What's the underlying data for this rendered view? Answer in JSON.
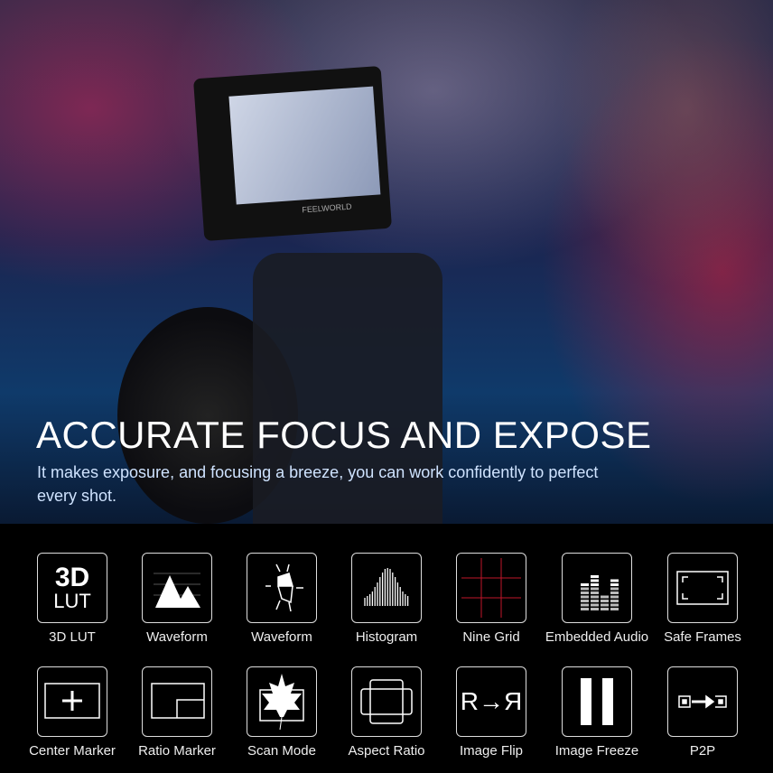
{
  "hero": {
    "headline": "ACCURATE FOCUS AND EXPOSE",
    "subtext": "It makes exposure, and focusing a breeze, you can work confidently to perfect every shot.",
    "monitor_brand": "FEELWORLD"
  },
  "features": [
    {
      "label": "3D LUT",
      "icon": "3d-lut-icon",
      "icon_text_top": "3D",
      "icon_text_bottom": "LUT"
    },
    {
      "label": "Waveform",
      "icon": "waveform-mountain-icon"
    },
    {
      "label": "Waveform",
      "icon": "waveform-vectorscope-icon"
    },
    {
      "label": "Histogram",
      "icon": "histogram-icon"
    },
    {
      "label": "Nine Grid",
      "icon": "nine-grid-icon"
    },
    {
      "label": "Embedded Audio",
      "icon": "audio-meter-icon"
    },
    {
      "label": "Safe Frames",
      "icon": "safe-frames-icon"
    },
    {
      "label": "Center Marker",
      "icon": "center-marker-icon"
    },
    {
      "label": "Ratio Marker",
      "icon": "ratio-marker-icon"
    },
    {
      "label": "Scan Mode",
      "icon": "scan-mode-leaf-icon"
    },
    {
      "label": "Aspect Ratio",
      "icon": "aspect-ratio-icon"
    },
    {
      "label": "Image Flip",
      "icon": "image-flip-icon",
      "icon_text": "R→Я"
    },
    {
      "label": "Image Freeze",
      "icon": "image-freeze-icon"
    },
    {
      "label": "P2P",
      "icon": "p2p-icon"
    }
  ],
  "colors": {
    "grid_line": "#c0162a",
    "background": "#000000"
  }
}
